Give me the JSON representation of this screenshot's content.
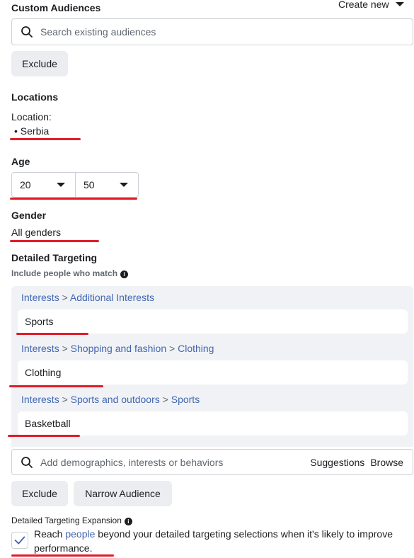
{
  "custom_audiences": {
    "heading": "Custom Audiences",
    "create_new": "Create new",
    "search_placeholder": "Search existing audiences",
    "exclude_label": "Exclude"
  },
  "locations": {
    "heading": "Locations",
    "label": "Location:",
    "items": [
      "Serbia"
    ]
  },
  "age": {
    "heading": "Age",
    "min": "20",
    "max": "50"
  },
  "gender": {
    "heading": "Gender",
    "value": "All genders"
  },
  "detailed_targeting": {
    "heading": "Detailed Targeting",
    "include_label": "Include people who match",
    "groups": [
      {
        "path": [
          "Interests",
          "Additional Interests"
        ],
        "item": "Sports"
      },
      {
        "path": [
          "Interests",
          "Shopping and fashion",
          "Clothing"
        ],
        "item": "Clothing"
      },
      {
        "path": [
          "Interests",
          "Sports and outdoors",
          "Sports"
        ],
        "item": "Basketball"
      }
    ],
    "separator": ">",
    "search_placeholder": "Add demographics, interests or behaviors",
    "suggestions_label": "Suggestions",
    "browse_label": "Browse",
    "exclude_label": "Exclude",
    "narrow_label": "Narrow Audience"
  },
  "expansion": {
    "heading": "Detailed Targeting Expansion",
    "text_before": "Reach ",
    "link_text": "people",
    "text_after": " beyond your detailed targeting selections when it's likely to improve performance.",
    "checked": true
  },
  "colors": {
    "accent_link": "#4267b2",
    "annotation_red": "#e21b27",
    "button_bg": "#ebedf0",
    "panel_bg": "#f0f2f5"
  }
}
